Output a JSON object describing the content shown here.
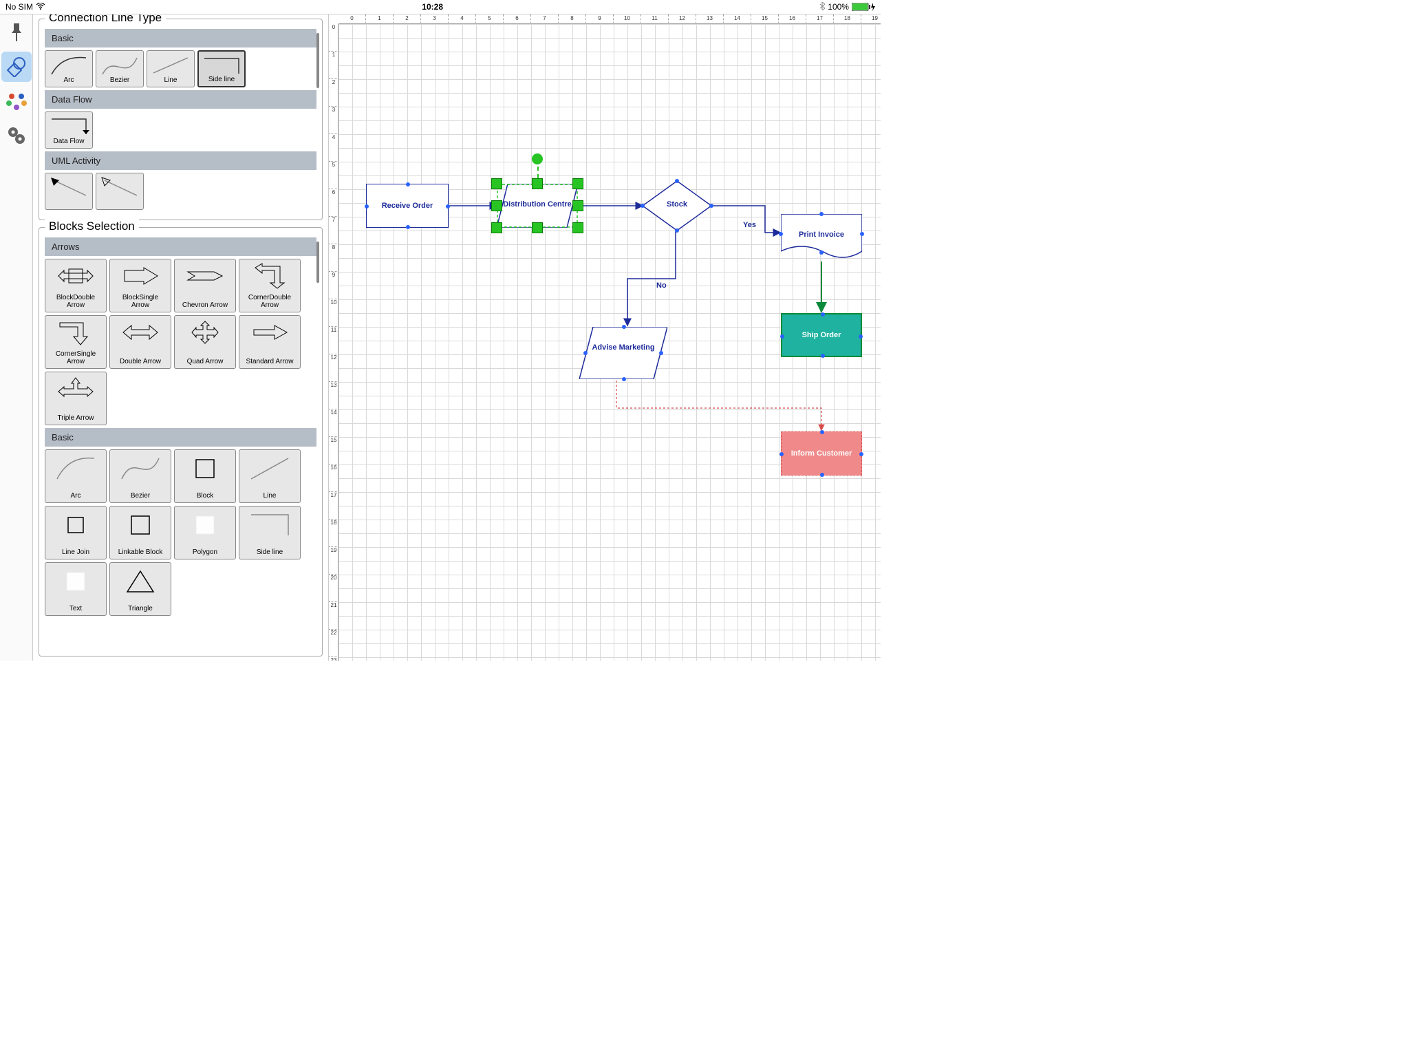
{
  "status": {
    "left": "No SIM",
    "time": "10:28",
    "battery": "100%"
  },
  "toolbar": {
    "active_index": 1
  },
  "palette": {
    "connection_title": "Connection Line Type",
    "blocks_title": "Blocks Selection",
    "conn_groups": [
      {
        "name": "Basic",
        "items": [
          "Arc",
          "Bezier",
          "Line",
          "Side line"
        ],
        "selected": "Side line"
      },
      {
        "name": "Data Flow",
        "items": [
          "Data Flow"
        ]
      },
      {
        "name": "UML Activity",
        "items": [
          "",
          ""
        ]
      }
    ],
    "block_groups": [
      {
        "name": "Arrows",
        "items": [
          "BlockDouble Arrow",
          "BlockSingle Arrow",
          "Chevron Arrow",
          "CornerDouble Arrow",
          "CornerSingle Arrow",
          "Double Arrow",
          "Quad Arrow",
          "Standard Arrow",
          "Triple Arrow"
        ]
      },
      {
        "name": "Basic",
        "items": [
          "Arc",
          "Bezier",
          "Block",
          "Line",
          "Line Join",
          "Linkable Block",
          "Polygon",
          "Side line",
          "Text",
          "Triangle"
        ]
      }
    ]
  },
  "ruler": {
    "count_h": 20,
    "count_v": 24,
    "step": 40
  },
  "flow": {
    "receive": "Receive Order",
    "dist": "Distribution Centre",
    "stock": "Stock",
    "yes": "Yes",
    "no": "No",
    "print": "Print Invoice",
    "ship": "Ship Order",
    "advise": "Advise Marketing",
    "inform": "Inform Customer"
  }
}
